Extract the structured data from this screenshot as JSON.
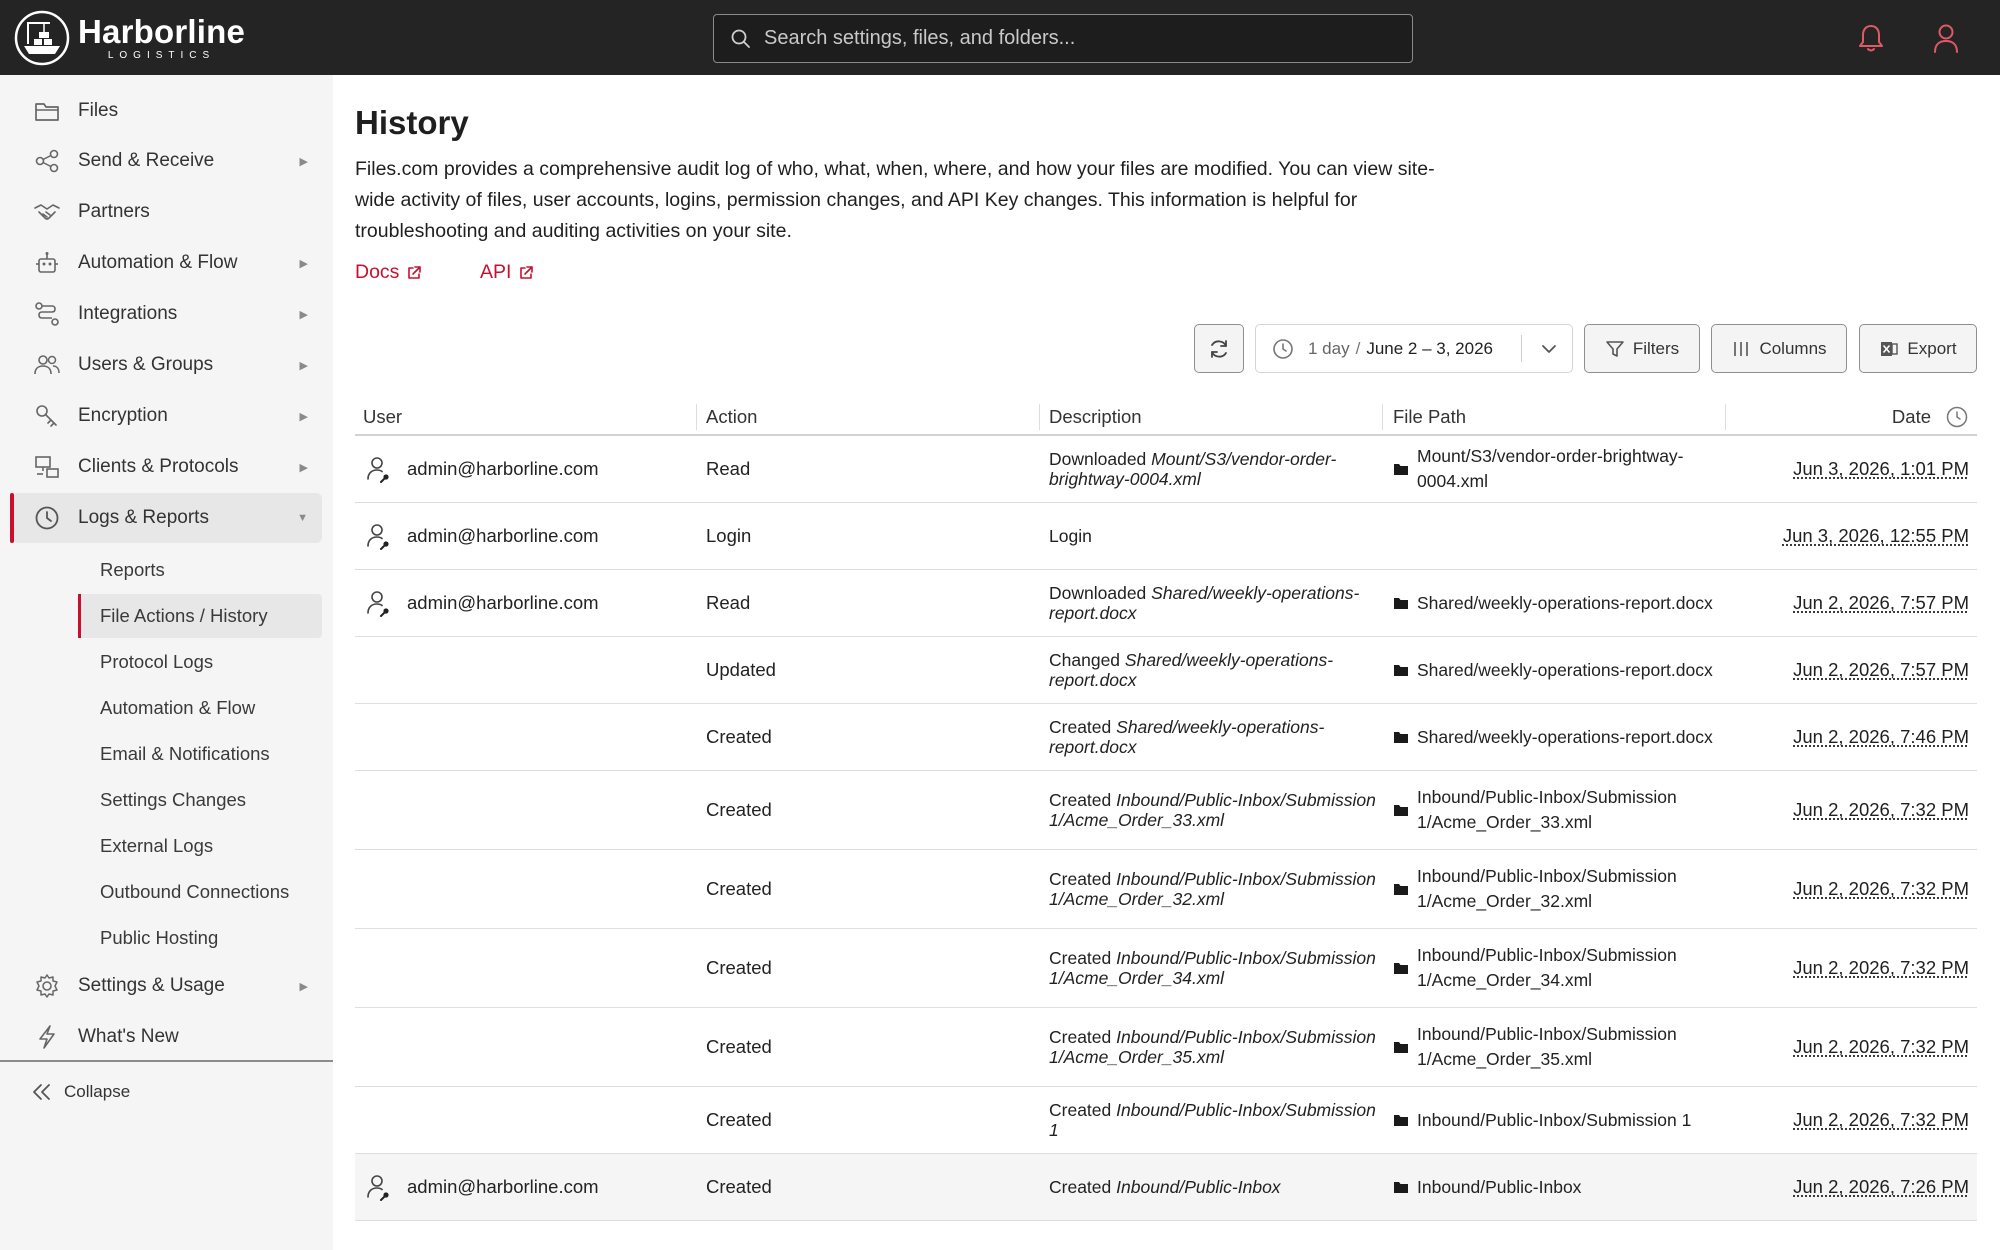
{
  "app": {
    "logo_name": "Harborline",
    "logo_sub": "LOGISTICS",
    "search_placeholder": "Search settings, files, and folders..."
  },
  "colors": {
    "accent": "#c8102e",
    "topbar": "#242424",
    "sidebar": "#f5f5f5"
  },
  "sidebar": {
    "items": [
      {
        "label": "Files",
        "icon": "folder-icon"
      },
      {
        "label": "Send & Receive",
        "icon": "share-icon"
      },
      {
        "label": "Partners",
        "icon": "handshake-icon"
      },
      {
        "label": "Automation & Flow",
        "icon": "robot-icon"
      },
      {
        "label": "Integrations",
        "icon": "integrations-icon"
      },
      {
        "label": "Users & Groups",
        "icon": "users-icon"
      },
      {
        "label": "Encryption",
        "icon": "key-icon"
      },
      {
        "label": "Clients & Protocols",
        "icon": "clients-icon"
      },
      {
        "label": "Logs & Reports",
        "icon": "clock-icon"
      },
      {
        "label": "Settings & Usage",
        "icon": "settings-icon"
      },
      {
        "label": "What's New",
        "icon": "lightning-icon"
      }
    ],
    "sub_items": [
      "Reports",
      "File Actions / History",
      "Protocol Logs",
      "Automation & Flow",
      "Email & Notifications",
      "Settings Changes",
      "External Logs",
      "Outbound Connections",
      "Public Hosting"
    ],
    "collapse_label": "Collapse"
  },
  "main": {
    "title": "History",
    "intro": "Files.com provides a comprehensive audit log of who, what, when, where, and how your files are modified. You can view site-wide activity of files, user accounts, logins, permission changes, and API Key changes. This information is helpful for troubleshooting and auditing activities on your site.",
    "links": {
      "docs": "Docs",
      "api": "API"
    },
    "toolbar": {
      "range_days": "1 day",
      "range_sep": "/",
      "range_dates": "June 2 – 3, 2026",
      "filters": "Filters",
      "columns": "Columns",
      "export": "Export"
    },
    "table": {
      "headers": {
        "user": "User",
        "action": "Action",
        "description": "Description",
        "path": "File Path",
        "date": "Date"
      },
      "rows": [
        {
          "user": "admin@harborline.com",
          "action": "Read",
          "desc_verb": "Downloaded",
          "desc_obj": "Mount/S3/vendor-order-brightway-0004.xml",
          "path": "Mount/S3/vendor-order-brightway-0004.xml",
          "date": "Jun 3, 2026, 1:01 PM"
        },
        {
          "user": "admin@harborline.com",
          "action": "Login",
          "desc_verb": "Login",
          "desc_obj": "",
          "path": "",
          "date": "Jun 3, 2026, 12:55 PM"
        },
        {
          "user": "admin@harborline.com",
          "action": "Read",
          "desc_verb": "Downloaded",
          "desc_obj": "Shared/weekly-operations-report.docx",
          "path": "Shared/weekly-operations-report.docx",
          "date": "Jun 2, 2026, 7:57 PM"
        },
        {
          "user": "",
          "action": "Updated",
          "desc_verb": "Changed",
          "desc_obj": "Shared/weekly-operations-report.docx",
          "path": "Shared/weekly-operations-report.docx",
          "date": "Jun 2, 2026, 7:57 PM"
        },
        {
          "user": "",
          "action": "Created",
          "desc_verb": "Created",
          "desc_obj": "Shared/weekly-operations-report.docx",
          "path": "Shared/weekly-operations-report.docx",
          "date": "Jun 2, 2026, 7:46 PM"
        },
        {
          "user": "",
          "action": "Created",
          "desc_verb": "Created",
          "desc_obj": "Inbound/Public-Inbox/Submission 1/Acme_Order_33.xml",
          "path": "Inbound/Public-Inbox/Submission 1/Acme_Order_33.xml",
          "date": "Jun 2, 2026, 7:32 PM"
        },
        {
          "user": "",
          "action": "Created",
          "desc_verb": "Created",
          "desc_obj": "Inbound/Public-Inbox/Submission 1/Acme_Order_32.xml",
          "path": "Inbound/Public-Inbox/Submission 1/Acme_Order_32.xml",
          "date": "Jun 2, 2026, 7:32 PM"
        },
        {
          "user": "",
          "action": "Created",
          "desc_verb": "Created",
          "desc_obj": "Inbound/Public-Inbox/Submission 1/Acme_Order_34.xml",
          "path": "Inbound/Public-Inbox/Submission 1/Acme_Order_34.xml",
          "date": "Jun 2, 2026, 7:32 PM"
        },
        {
          "user": "",
          "action": "Created",
          "desc_verb": "Created",
          "desc_obj": "Inbound/Public-Inbox/Submission 1/Acme_Order_35.xml",
          "path": "Inbound/Public-Inbox/Submission 1/Acme_Order_35.xml",
          "date": "Jun 2, 2026, 7:32 PM"
        },
        {
          "user": "",
          "action": "Created",
          "desc_verb": "Created",
          "desc_obj": "Inbound/Public-Inbox/Submission 1",
          "path": "Inbound/Public-Inbox/Submission 1",
          "date": "Jun 2, 2026, 7:32 PM"
        },
        {
          "user": "admin@harborline.com",
          "action": "Created",
          "desc_verb": "Created",
          "desc_obj": "Inbound/Public-Inbox",
          "path": "Inbound/Public-Inbox",
          "date": "Jun 2, 2026, 7:26 PM"
        }
      ]
    }
  }
}
